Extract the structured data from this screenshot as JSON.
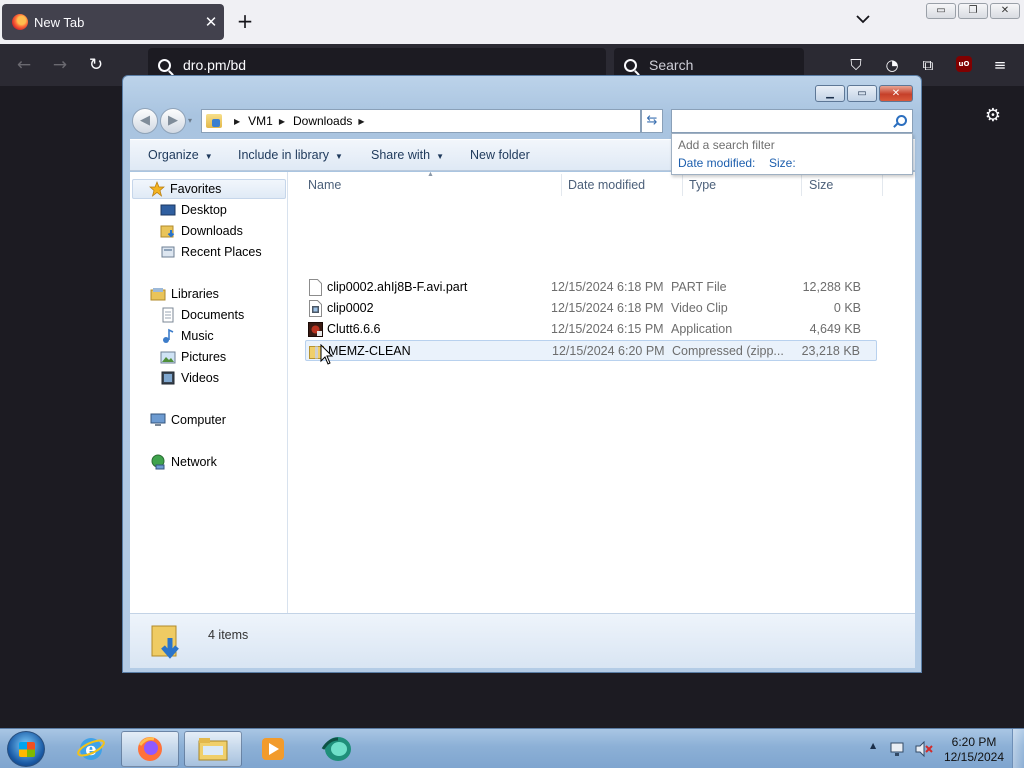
{
  "browser": {
    "tab_title": "New Tab",
    "tab_close": "✕",
    "new_tab": "+",
    "url": "dro.pm/bd",
    "search_placeholder": "Search"
  },
  "explorer": {
    "breadcrumb": [
      "VM1",
      "Downloads"
    ],
    "search_hint": "Add a search filter",
    "search_filters": [
      "Date modified:",
      "Size:"
    ],
    "commands": {
      "organize": "Organize",
      "include": "Include in library",
      "share": "Share with",
      "new_folder": "New folder"
    },
    "nav": {
      "favorites": "Favorites",
      "desktop": "Desktop",
      "downloads": "Downloads",
      "recent": "Recent Places",
      "libraries": "Libraries",
      "documents": "Documents",
      "music": "Music",
      "pictures": "Pictures",
      "videos": "Videos",
      "computer": "Computer",
      "network": "Network"
    },
    "columns": {
      "name": "Name",
      "date": "Date modified",
      "type": "Type",
      "size": "Size"
    },
    "files": [
      {
        "name": "clip0002.ahIj8B-F.avi.part",
        "date": "12/15/2024 6:18 PM",
        "type": "PART File",
        "size": "12,288 KB"
      },
      {
        "name": "clip0002",
        "date": "12/15/2024 6:18 PM",
        "type": "Video Clip",
        "size": "0 KB"
      },
      {
        "name": "Clutt6.6.6",
        "date": "12/15/2024 6:15 PM",
        "type": "Application",
        "size": "4,649 KB"
      },
      {
        "name": "MEMZ-CLEAN",
        "date": "12/15/2024 6:20 PM",
        "type": "Compressed (zipp...",
        "size": "23,218 KB"
      }
    ],
    "item_count": "4 items"
  },
  "taskbar": {
    "time": "6:20 PM",
    "date": "12/15/2024"
  },
  "colors": {
    "ff_dark": "#2b2a33",
    "win_glass": "#b4cce6",
    "link_blue": "#1d5fae"
  }
}
